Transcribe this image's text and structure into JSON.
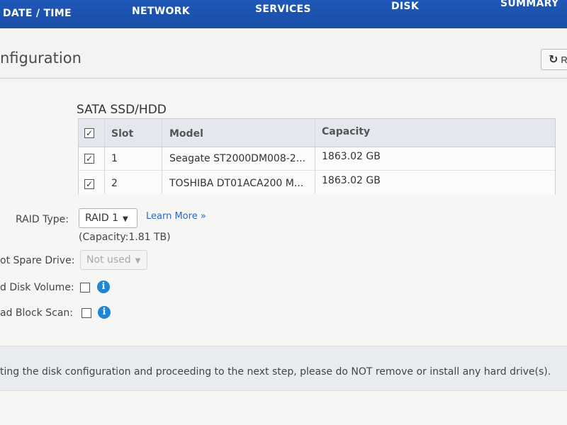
{
  "nav": {
    "items": [
      "DATE / TIME",
      "NETWORK",
      "SERVICES",
      "DISK",
      "SUMMARY"
    ]
  },
  "header": {
    "title": "nfiguration",
    "refresh_label": "R"
  },
  "section": {
    "title": "SATA SSD/HDD",
    "columns": [
      "Slot",
      "Model",
      "Capacity"
    ],
    "rows": [
      {
        "checked": true,
        "slot": "1",
        "model": "Seagate ST2000DM008-2...",
        "capacity": "1863.02 GB"
      },
      {
        "checked": true,
        "slot": "2",
        "model": "TOSHIBA DT01ACA200 M...",
        "capacity": "1863.02 GB"
      }
    ]
  },
  "form": {
    "raid_label": "RAID Type:",
    "raid_value": "RAID 1",
    "learn_more": "Learn More »",
    "capacity_note": "(Capacity:1.81 TB)",
    "hot_spare_label": "ot Spare Drive:",
    "hot_spare_value": "Not used",
    "encrypted_label": "d Disk Volume:",
    "bad_block_label": "ad Block Scan:"
  },
  "notice": {
    "text": "ting the disk configuration and proceeding to the next step, please do NOT remove or install any hard drive(s)."
  },
  "colors": {
    "nav_bg": "#1f58b8",
    "info_icon": "#1f86d6",
    "link": "#2a67c3"
  }
}
